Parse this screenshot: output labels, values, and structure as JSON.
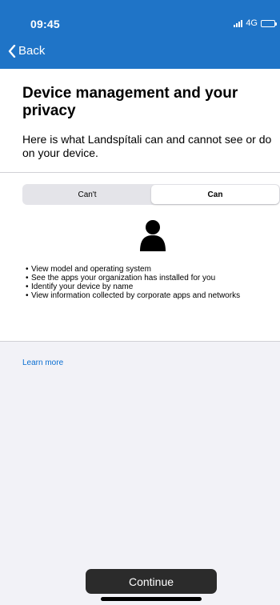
{
  "status_bar": {
    "time": "09:45",
    "network": "4G",
    "signal_bars": 4,
    "battery_level": 1.0
  },
  "nav": {
    "back_label": "Back",
    "back_icon": "chevron-left-icon"
  },
  "intro": {
    "title": "Device management and your privacy",
    "description": "Here is what Landspítali can and cannot see or do on your device."
  },
  "segmented_control": {
    "tabs": [
      {
        "label": "Can't",
        "active": false
      },
      {
        "label": "Can",
        "active": true
      }
    ]
  },
  "illustration_icon": "person-icon",
  "can_list": [
    "View model and operating system",
    "See the apps your organization has installed for you",
    "Identify your device by name",
    "View information collected by corporate apps and networks"
  ],
  "learn_more_label": "Learn more",
  "continue_label": "Continue",
  "colors": {
    "header_blue": "#1f74c7",
    "link_blue": "#0a6ed1",
    "button_dark": "#2b2b2b",
    "background": "#f2f2f7"
  }
}
